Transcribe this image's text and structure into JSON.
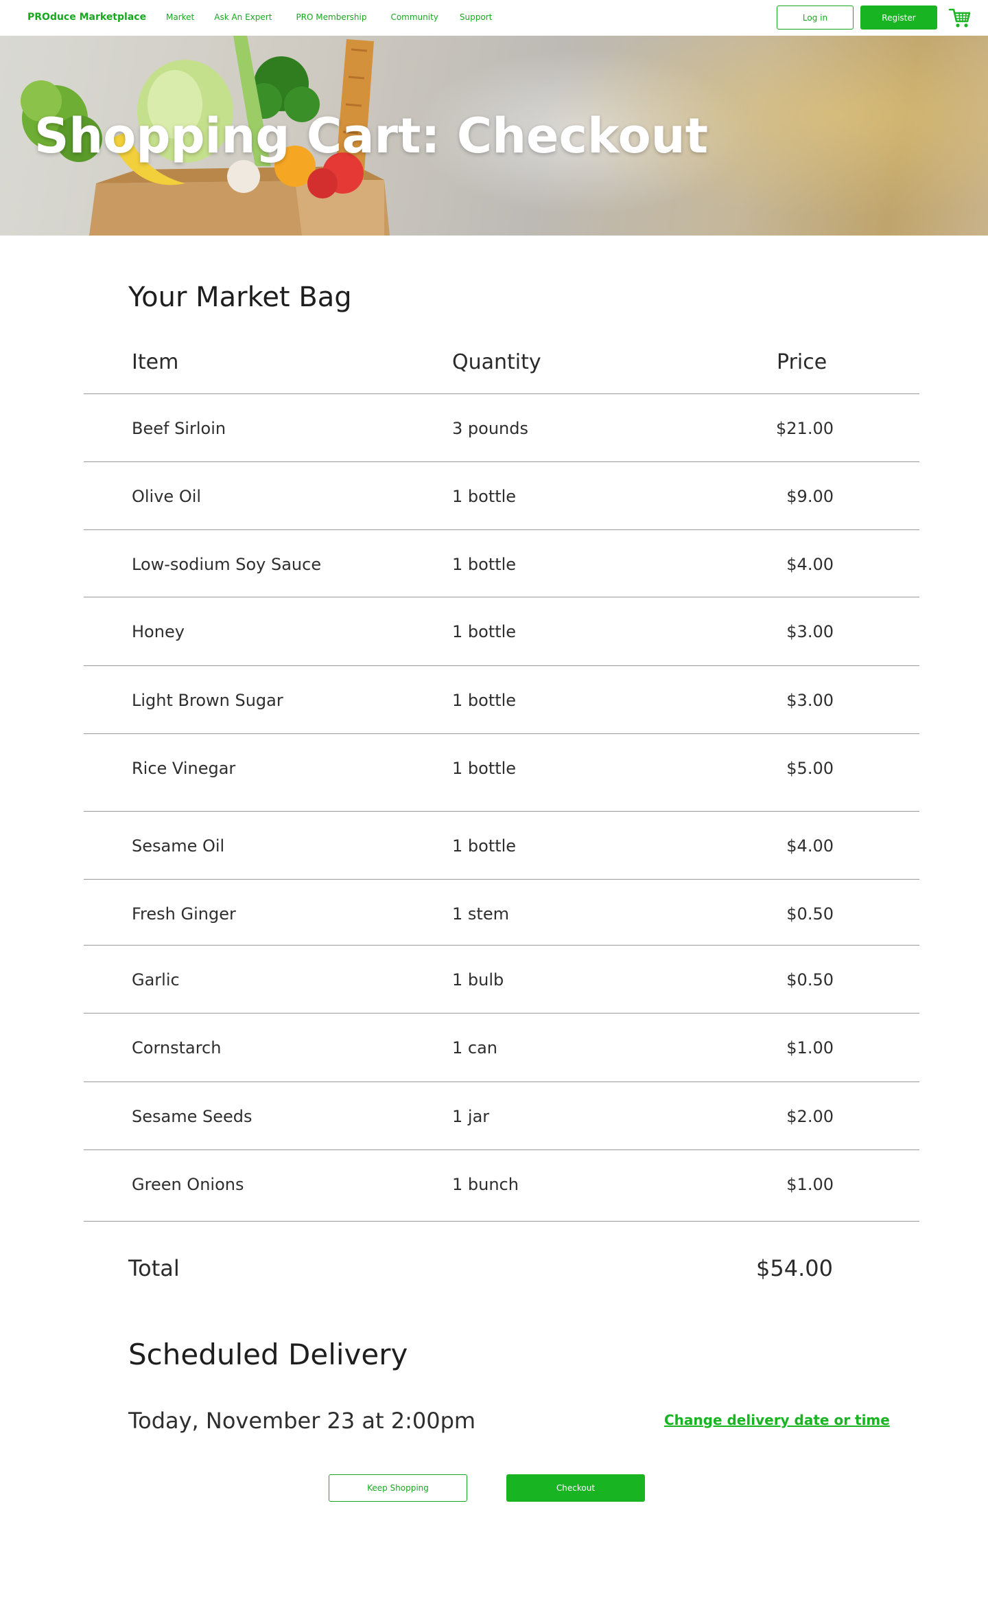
{
  "nav": {
    "brand": "PROduce Marketplace",
    "links": [
      "Market",
      "Ask An Expert",
      "PRO Membership",
      "Community",
      "Support"
    ],
    "login_label": "Log in",
    "register_label": "Register",
    "cart_icon": "shopping-cart-icon"
  },
  "hero": {
    "title": "Shopping Cart: Checkout"
  },
  "cart": {
    "title": "Your Market Bag",
    "columns": [
      "Item",
      "Quantity",
      "Price"
    ],
    "rows": [
      {
        "item": "Beef Sirloin",
        "quantity": "3 pounds",
        "price": "$21.00"
      },
      {
        "item": "Olive Oil",
        "quantity": "1 bottle",
        "price": "$9.00"
      },
      {
        "item": "Low-sodium Soy Sauce",
        "quantity": "1 bottle",
        "price": "$4.00"
      },
      {
        "item": "Honey",
        "quantity": "1 bottle",
        "price": "$3.00"
      },
      {
        "item": "Light Brown Sugar",
        "quantity": "1 bottle",
        "price": "$3.00"
      },
      {
        "item": "Rice Vinegar",
        "quantity": "1 bottle",
        "price": "$5.00"
      },
      {
        "item": "Sesame Oil",
        "quantity": "1 bottle",
        "price": "$4.00"
      },
      {
        "item": "Fresh Ginger",
        "quantity": "1 stem",
        "price": "$0.50"
      },
      {
        "item": "Garlic",
        "quantity": "1 bulb",
        "price": "$0.50"
      },
      {
        "item": "Cornstarch",
        "quantity": "1 can",
        "price": "$1.00"
      },
      {
        "item": "Sesame Seeds",
        "quantity": "1 jar",
        "price": "$2.00"
      },
      {
        "item": "Green Onions",
        "quantity": "1 bunch",
        "price": "$1.00"
      }
    ],
    "total_label": "Total",
    "total_value": "$54.00"
  },
  "delivery": {
    "title": "Scheduled Delivery",
    "date": "Today, November 23 at 2:00pm",
    "change_link": "Change delivery date or time"
  },
  "actions": {
    "keep_shopping": "Keep Shopping",
    "checkout": "Checkout"
  },
  "colors": {
    "accent": "#19b422"
  }
}
